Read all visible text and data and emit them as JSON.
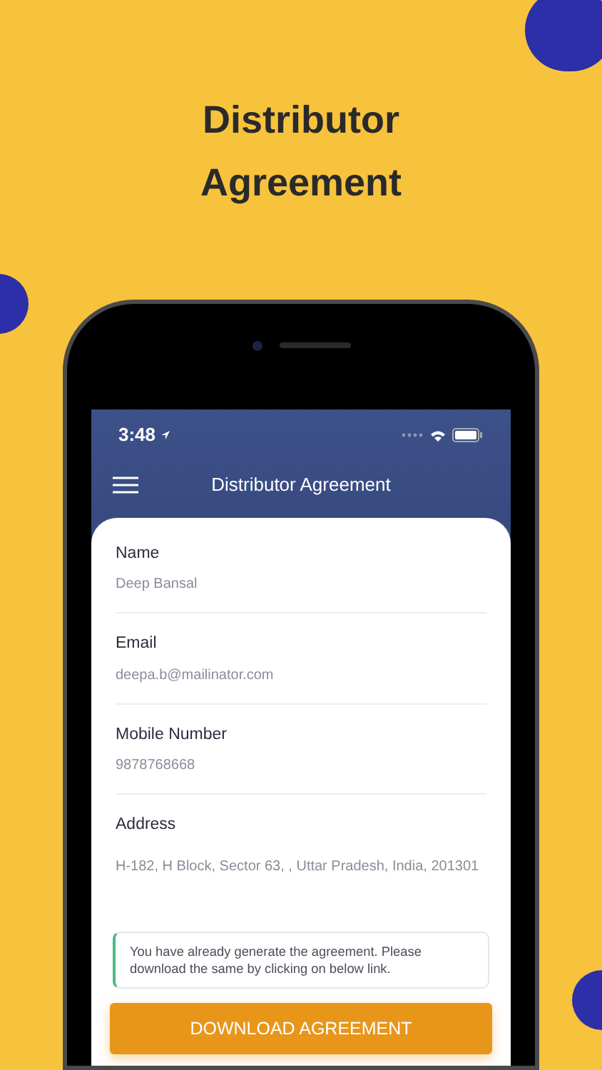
{
  "headline": "Distributor Agreement",
  "status_bar": {
    "time": "3:48"
  },
  "nav": {
    "title": "Distributor Agreement"
  },
  "fields": [
    {
      "label": "Name",
      "value": "Deep Bansal"
    },
    {
      "label": "Email",
      "value": "deepa.b@mailinator.com"
    },
    {
      "label": "Mobile Number",
      "value": "9878768668"
    },
    {
      "label": "Address",
      "value": "H-182, H Block, Sector 63, , Uttar Pradesh, India, 201301"
    }
  ],
  "notice": "You have already generate the agreement. Please download the same by clicking on below link.",
  "button": "DOWNLOAD AGREEMENT"
}
